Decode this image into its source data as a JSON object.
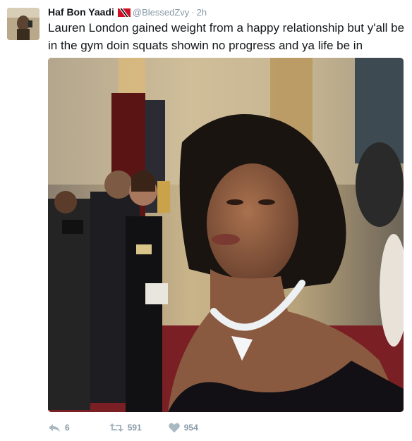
{
  "tweet": {
    "display_name": "Haf Bon Yaadi",
    "handle": "@BlessedZvy",
    "separator": "·",
    "time": "2h",
    "text": "Lauren London gained weight from a happy relationship but y'all be in the gym doin squats showin no progress and ya life be in shambles.",
    "flag_icon": "trinidad-and-tobago-flag-icon",
    "colors": {
      "name": "#14171a",
      "meta": "#8899a6",
      "icon": "#aab8c2"
    }
  },
  "actions": {
    "reply": {
      "icon": "reply-icon",
      "count": "6"
    },
    "retweet": {
      "icon": "retweet-icon",
      "count": "591"
    },
    "like": {
      "icon": "heart-icon",
      "count": "954"
    }
  }
}
